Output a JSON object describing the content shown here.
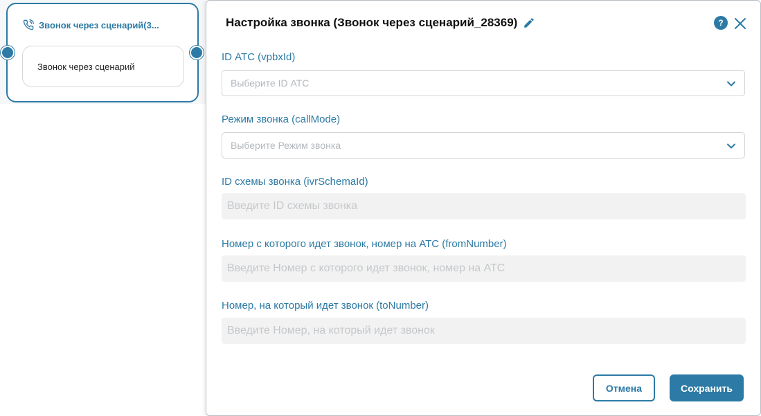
{
  "node": {
    "title": "Звонок через сценарий(3...",
    "body_text": "Звонок через сценарий",
    "icon": "phone-call-icon"
  },
  "modal": {
    "title": "Настройка звонка (Звонок через сценарий_28369)",
    "help_label": "?",
    "fields": [
      {
        "label": "ID АТС (vpbxId)",
        "placeholder": "Выберите ID АТС",
        "type": "select"
      },
      {
        "label": "Режим звонка (callMode)",
        "placeholder": "Выберите Режим звонка",
        "type": "select"
      },
      {
        "label": "ID схемы звонка (ivrSchemaId)",
        "placeholder": "Введите ID схемы звонка",
        "type": "text"
      },
      {
        "label": "Номер с которого идет звонок, номер на АТС (fromNumber)",
        "placeholder": "Введите Номер с которого идет звонок, номер на АТС",
        "type": "text"
      },
      {
        "label": "Номер, на который идет звонок (toNumber)",
        "placeholder": "Введите Номер, на который идет звонок",
        "type": "text"
      }
    ],
    "cancel_label": "Отмена",
    "save_label": "Сохранить"
  },
  "colors": {
    "accent": "#2c7aa5",
    "placeholder": "#b3b8bd",
    "input_bg": "#f2f2f2"
  }
}
